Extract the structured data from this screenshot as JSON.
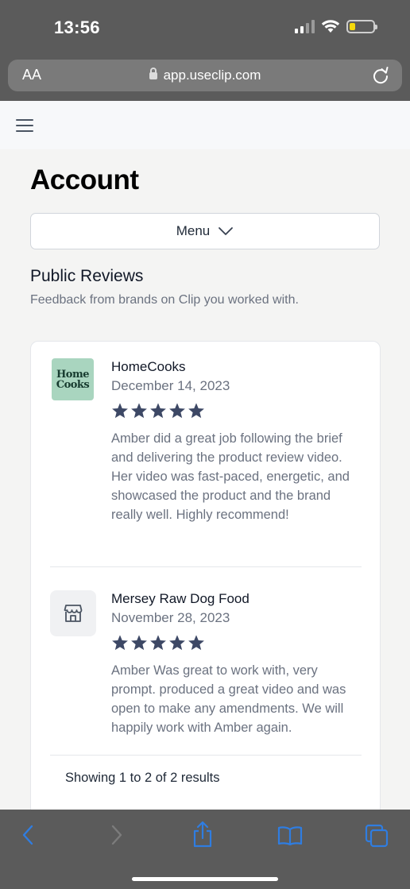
{
  "status_bar": {
    "time": "13:56"
  },
  "browser": {
    "text_size_label": "AA",
    "url": "app.useclip.com"
  },
  "page": {
    "title": "Account",
    "menu_label": "Menu",
    "section_title": "Public Reviews",
    "section_subtitle": "Feedback from brands on Clip you worked with."
  },
  "reviews": [
    {
      "brand": "HomeCooks",
      "logo_line1": "Home",
      "logo_line2": "Cooks",
      "date": "December 14, 2023",
      "rating": 5,
      "text": "Amber did a great job following the brief and delivering the product review video. Her video was fast-paced, energetic, and showcased the product and the brand really well. Highly recommend!"
    },
    {
      "brand": "Mersey Raw Dog Food",
      "logo_icon": "store-icon",
      "date": "November 28, 2023",
      "rating": 5,
      "text": "Amber Was great to work with, very prompt. produced a great video and was open to make any amendments. We will happily work with Amber again."
    }
  ],
  "pagination": {
    "summary": "Showing 1 to 2 of 2 results"
  },
  "colors": {
    "star": "#3d4865",
    "browser_chrome": "#5b5b5b",
    "toolbar_icon": "#2f7de1",
    "homecooks_logo_bg": "#a9d5bf"
  }
}
